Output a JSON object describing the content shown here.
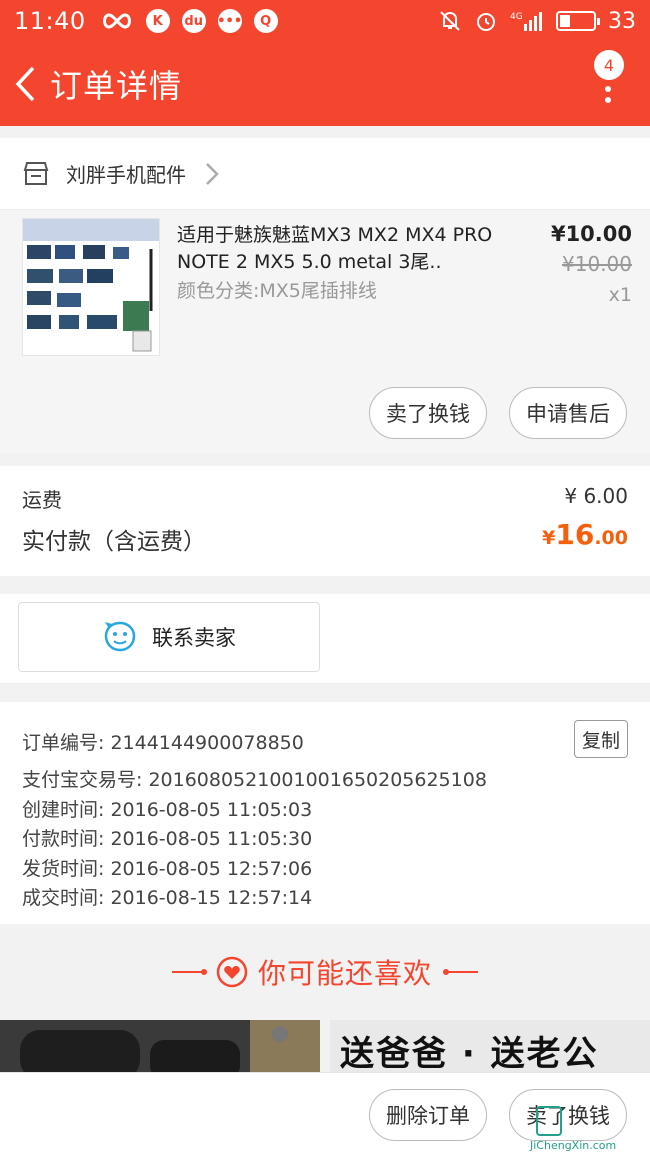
{
  "status_bar": {
    "time": "11:40",
    "battery": "33",
    "signal": "4G"
  },
  "nav": {
    "title": "订单详情",
    "badge": "4"
  },
  "shop": {
    "name": "刘胖手机配件"
  },
  "product": {
    "title": "适用于魅族魅蓝MX3 MX2 MX4 PRO NOTE 2 MX5 5.0 metal 3尾..",
    "sku": "颜色分类:MX5尾插排线",
    "price": "¥10.00",
    "original_price": "¥10.00",
    "quantity": "x1"
  },
  "actions": {
    "sell_exchange": "卖了换钱",
    "after_sale": "申请售后"
  },
  "fees": {
    "shipping_label": "运费",
    "shipping_value": "¥ 6.00",
    "paid_label": "实付款（含运费）",
    "paid_currency": "¥",
    "paid_int": "16",
    "paid_dec": ".00"
  },
  "contact": {
    "label": "联系卖家"
  },
  "order_info": {
    "copy_label": "复制",
    "lines": [
      "订单编号: 2144144900078850",
      "支付宝交易号: 2016080521001001650205625108",
      "创建时间: 2016-08-05 11:05:03",
      "付款时间: 2016-08-05 11:05:30",
      "发货时间: 2016-08-05 12:57:06",
      "成交时间: 2016-08-15 12:57:14"
    ]
  },
  "recommend": {
    "title": "你可能还喜欢",
    "card2_text": "送爸爸 · 送老公"
  },
  "bottom": {
    "delete_order": "删除订单",
    "sell_exchange": "卖了换钱"
  },
  "colors": {
    "brand": "#f4452e",
    "price_accent": "#f4600c",
    "info_icon": "#29a8e0"
  },
  "watermark": {
    "url": "JiChengXin.com"
  }
}
